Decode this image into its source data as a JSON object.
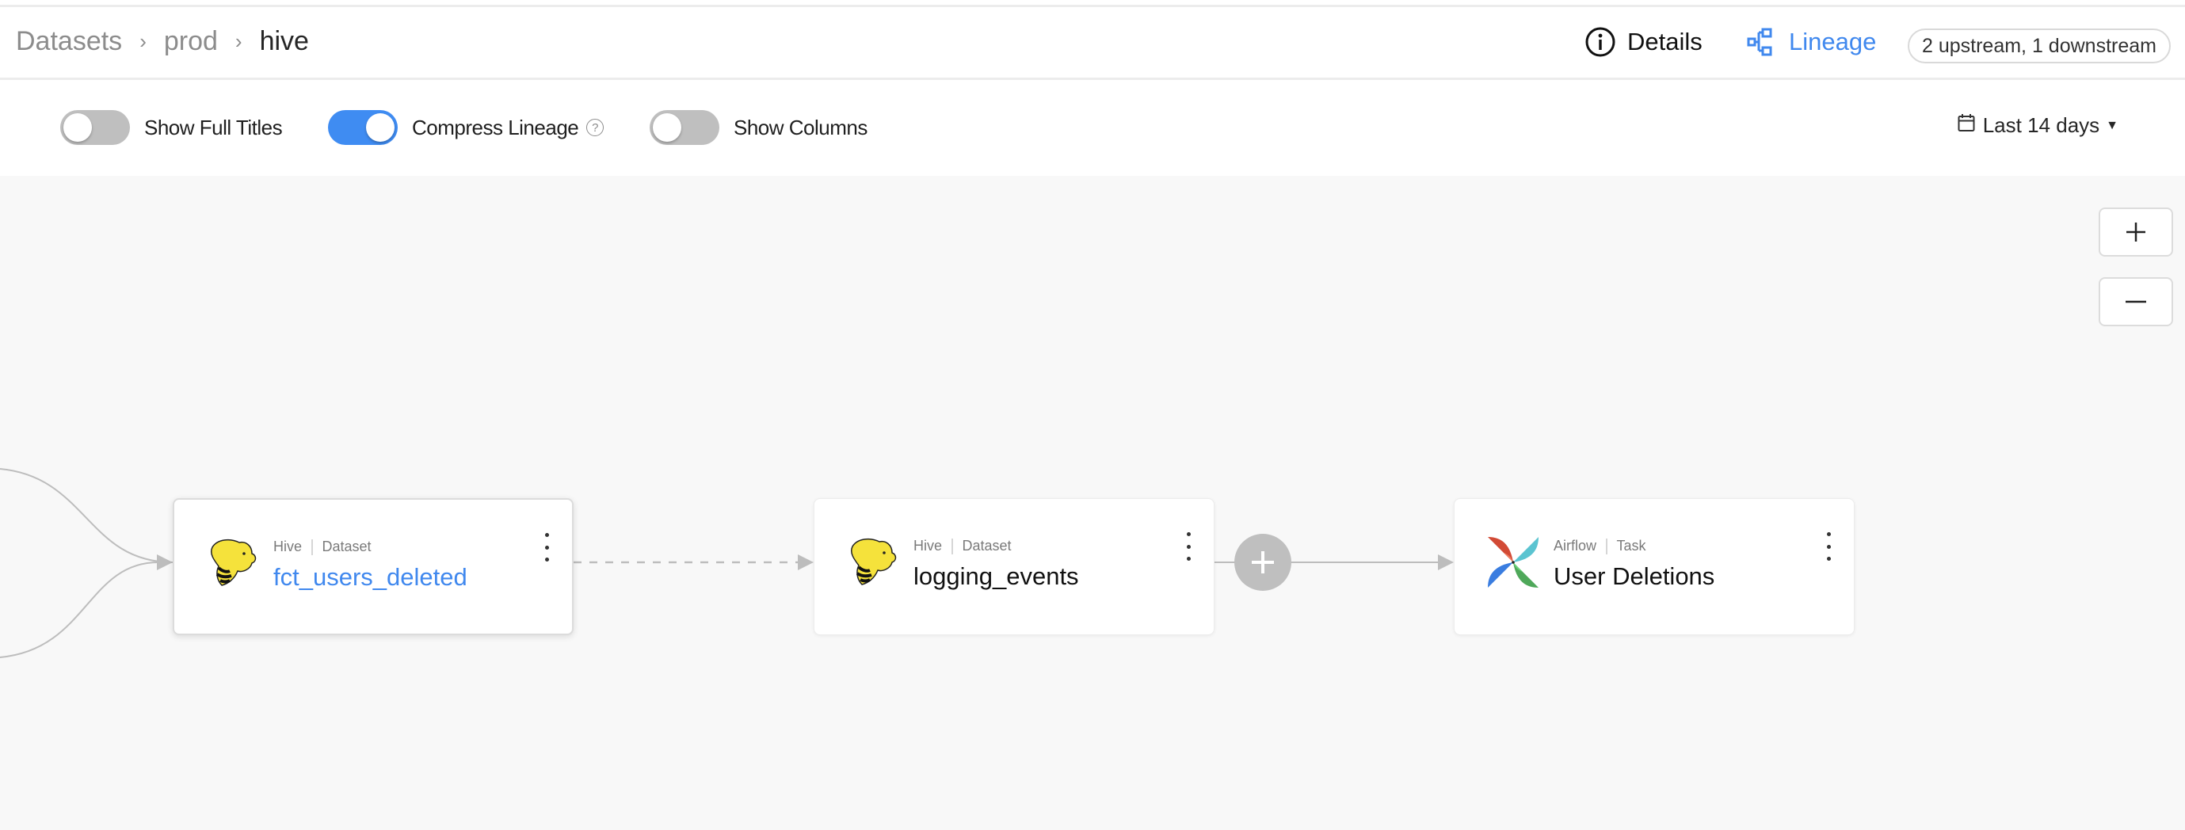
{
  "breadcrumb": {
    "items": [
      "Datasets",
      "prod",
      "hive"
    ],
    "separator": "›"
  },
  "header": {
    "tabs": [
      {
        "label": "Details",
        "icon": "info-icon",
        "active": false
      },
      {
        "label": "Lineage",
        "icon": "lineage-icon",
        "active": true
      }
    ],
    "lineage_summary": "2 upstream, 1 downstream",
    "accent_color": "#4088ee"
  },
  "controls": {
    "toggles": [
      {
        "label": "Show Full Titles",
        "on": false
      },
      {
        "label": "Compress Lineage",
        "on": true,
        "help_icon": "?"
      },
      {
        "label": "Show Columns",
        "on": false
      }
    ],
    "date_range": {
      "selected": "Last 14 days",
      "icon": "calendar-icon"
    }
  },
  "canvas": {
    "zoom_in_label": "+",
    "zoom_out_label": "—",
    "expand_label": "+",
    "nodes": [
      {
        "platform": "Hive",
        "type": "Dataset",
        "name": "fct_users_deleted",
        "logo": "hive-logo",
        "selected": true
      },
      {
        "platform": "Hive",
        "type": "Dataset",
        "name": "logging_events",
        "logo": "hive-logo",
        "selected": false
      },
      {
        "platform": "Airflow",
        "type": "Task",
        "name": "User Deletions",
        "logo": "airflow-logo",
        "selected": false
      }
    ],
    "edges": [
      {
        "from": "upstream-1",
        "to": "fct_users_deleted",
        "style": "solid"
      },
      {
        "from": "upstream-2",
        "to": "fct_users_deleted",
        "style": "solid"
      },
      {
        "from": "fct_users_deleted",
        "to": "logging_events",
        "style": "dashed"
      },
      {
        "from": "logging_events",
        "to": "User Deletions",
        "style": "solid"
      }
    ]
  }
}
